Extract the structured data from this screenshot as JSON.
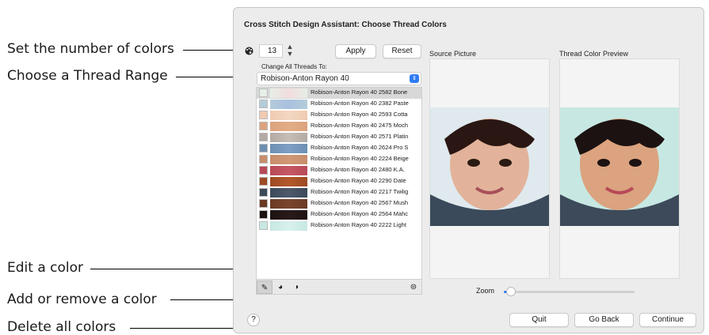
{
  "callouts": {
    "set_number": "Set the number of colors",
    "choose_range": "Choose a Thread Range",
    "edit_color": "Edit a color",
    "add_remove": "Add or remove a color",
    "delete_all": "Delete all colors"
  },
  "dialog": {
    "title": "Cross Stitch Design Assistant: Choose Thread Colors",
    "color_count": "13",
    "apply_label": "Apply",
    "reset_label": "Reset",
    "change_all_label": "Change All Threads To:",
    "thread_range": "Robison-Anton Rayon 40",
    "threads": [
      {
        "label": "Robison-Anton Rayon 40 2582 Bone",
        "color": "#e6efe6",
        "grad": "#f2dcdc"
      },
      {
        "label": "Robison-Anton Rayon 40 2382 Paste",
        "color": "#b4ccda",
        "grad": "#a9c0de"
      },
      {
        "label": "Robison-Anton Rayon 40 2593 Cotta",
        "color": "#efcbb1",
        "grad": "#f2d7c2"
      },
      {
        "label": "Robison-Anton Rayon 40 2475 Moch",
        "color": "#dba37f",
        "grad": "#e3ad86"
      },
      {
        "label": "Robison-Anton Rayon 40 2571 Platin",
        "color": "#b3aaa4",
        "grad": "#c7bdb7"
      },
      {
        "label": "Robison-Anton Rayon 40 2624 Pro S",
        "color": "#6d8fb1",
        "grad": "#7f9fc3"
      },
      {
        "label": "Robison-Anton Rayon 40 2224 Beige",
        "color": "#c78d6c",
        "grad": "#d19876"
      },
      {
        "label": "Robison-Anton Rayon 40 2480 K.A.",
        "color": "#b84a58",
        "grad": "#c65866"
      },
      {
        "label": "Robison-Anton Rayon 40 2290 Date",
        "color": "#9c4a24",
        "grad": "#b4582c"
      },
      {
        "label": "Robison-Anton Rayon 40 2217 Twilig",
        "color": "#3c4a5a",
        "grad": "#4d5a6b"
      },
      {
        "label": "Robison-Anton Rayon 40 2567 Mush",
        "color": "#6a3a24",
        "grad": "#7a452c"
      },
      {
        "label": "Robison-Anton Rayon 40 2564 Mahc",
        "color": "#1c1212",
        "grad": "#2a1a1a"
      },
      {
        "label": "Robison-Anton Rayon 40 2222 Light",
        "color": "#c7e8e2",
        "grad": "#d8f1ed"
      }
    ],
    "source_label": "Source Picture",
    "preview_label": "Thread Color Preview",
    "zoom_label": "Zoom",
    "zoom_level": 0.04,
    "help_label": "?",
    "quit_label": "Quit",
    "goback_label": "Go Back",
    "continue_label": "Continue",
    "accent_color": "#2f7cf6"
  }
}
